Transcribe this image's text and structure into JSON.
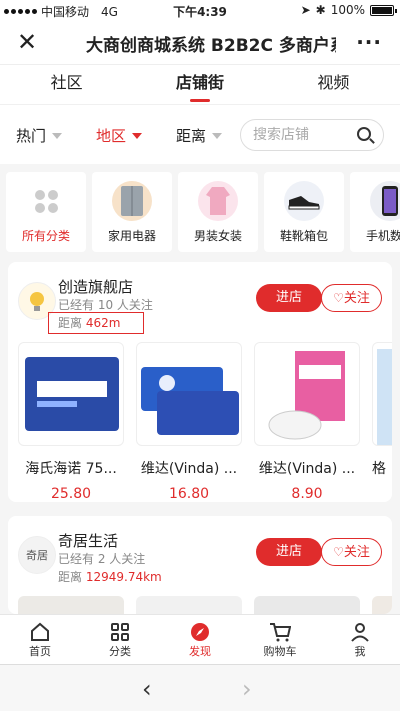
{
  "status_bar": {
    "carrier": "中国移动",
    "network": "4G",
    "time": "下午4:39",
    "battery": "100%"
  },
  "title_bar": {
    "title": "大商创商城系统 B2B2C 多商户系"
  },
  "tabs": [
    {
      "label": "社区",
      "active": false
    },
    {
      "label": "店铺街",
      "active": true
    },
    {
      "label": "视频",
      "active": false
    }
  ],
  "filters": [
    {
      "label": "热门",
      "active": false
    },
    {
      "label": "地区",
      "active": true
    },
    {
      "label": "距离",
      "active": false
    }
  ],
  "search": {
    "placeholder": "搜索店铺"
  },
  "categories": [
    {
      "label": "所有分类",
      "active": true,
      "icon": "grid-icon"
    },
    {
      "label": "家用电器",
      "active": false,
      "icon": "fridge-icon"
    },
    {
      "label": "男装女装",
      "active": false,
      "icon": "clothes-icon"
    },
    {
      "label": "鞋靴箱包",
      "active": false,
      "icon": "shoe-icon"
    },
    {
      "label": "手机数码",
      "active": false,
      "icon": "phone-icon"
    }
  ],
  "shops": [
    {
      "name": "创造旗舰店",
      "followers": "已经有 10 人关注",
      "distance_label": "距离",
      "distance_value": "462m",
      "enter_label": "进店",
      "follow_label": "关注",
      "products": [
        {
          "name": "海氏海诺 75...",
          "price": "25.80"
        },
        {
          "name": "维达(Vinda) ...",
          "price": "16.80"
        },
        {
          "name": "维达(Vinda) ...",
          "price": "8.90"
        },
        {
          "name": "格",
          "price": ""
        }
      ]
    },
    {
      "name": "奇居生活",
      "followers": "已经有 2 人关注",
      "distance_label": "距离",
      "distance_value": "12949.74km",
      "enter_label": "进店",
      "follow_label": "关注",
      "logo_text": "奇居"
    }
  ],
  "bottom_nav": [
    {
      "label": "首页",
      "icon": "home-icon",
      "active": false
    },
    {
      "label": "分类",
      "icon": "category-icon",
      "active": false
    },
    {
      "label": "发现",
      "icon": "discover-icon",
      "active": true
    },
    {
      "label": "购物车",
      "icon": "cart-icon",
      "active": false
    },
    {
      "label": "我",
      "icon": "user-icon",
      "active": false
    }
  ],
  "colors": {
    "accent": "#e02c2c"
  }
}
